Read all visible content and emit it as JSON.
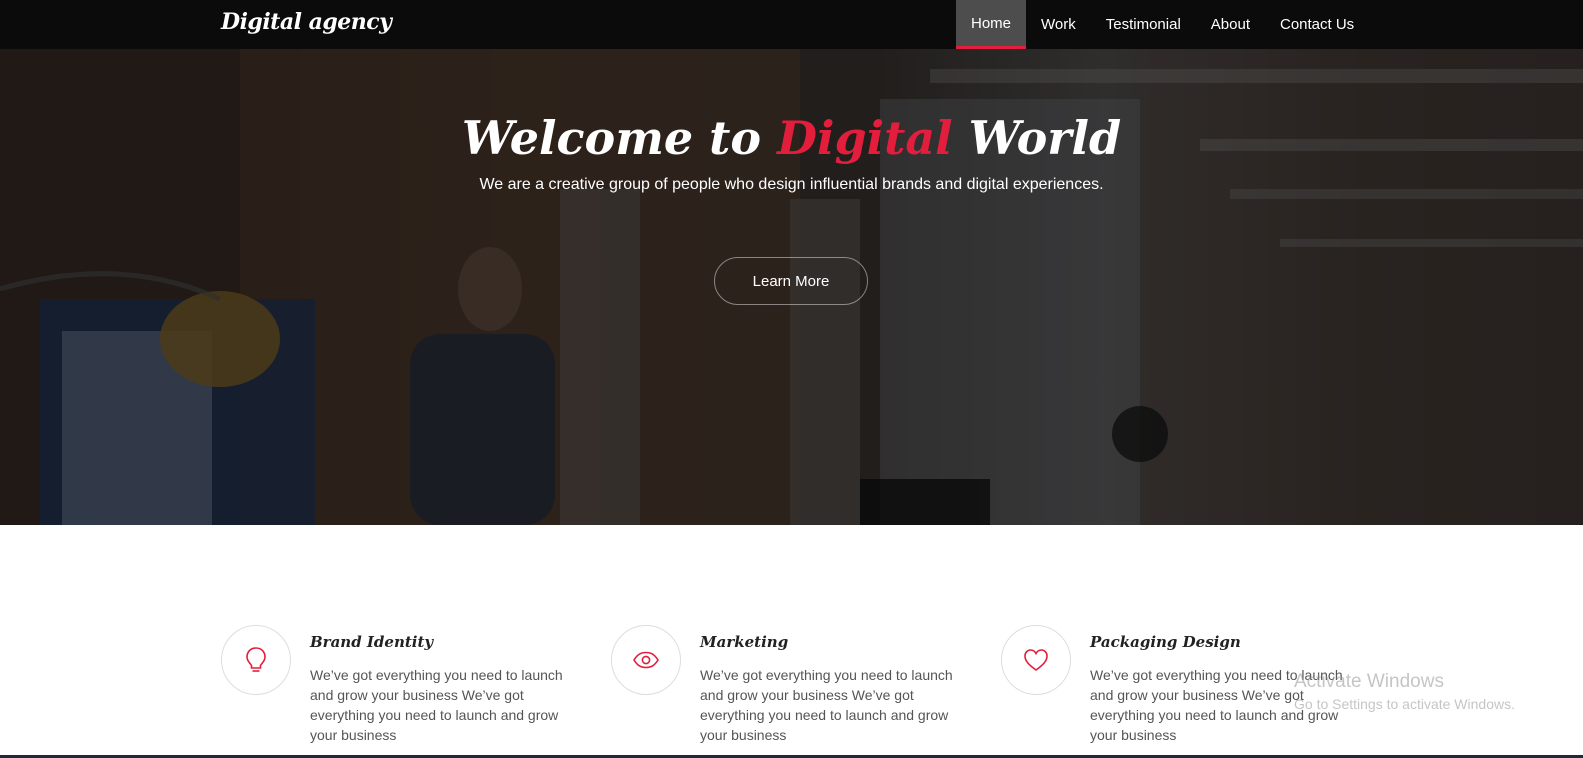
{
  "navbar": {
    "brand": "Digital agency",
    "items": [
      {
        "label": "Home",
        "active": true
      },
      {
        "label": "Work",
        "active": false
      },
      {
        "label": "Testimonial",
        "active": false
      },
      {
        "label": "About",
        "active": false
      },
      {
        "label": "Contact Us",
        "active": false
      }
    ]
  },
  "hero": {
    "title_prefix": "Welcome to",
    "title_accent": "Digital",
    "title_suffix": "World",
    "subtitle": "We are a creative group of people who design influential brands and digital experiences.",
    "cta_label": "Learn More"
  },
  "services": [
    {
      "icon": "lightbulb-icon",
      "title": "Brand Identity",
      "text": "We’ve got everything you need to launch and grow your business We’ve got everything you need to launch and grow your business"
    },
    {
      "icon": "eye-icon",
      "title": "Marketing",
      "text": "We’ve got everything you need to launch and grow your business We’ve got everything you need to launch and grow your business"
    },
    {
      "icon": "heart-icon",
      "title": "Packaging Design",
      "text": "We’ve got everything you need to launch and grow your business We’ve got everything you need to launch and grow your business"
    }
  ],
  "watermark": {
    "line1": "Activate Windows",
    "line2": "Go to Settings to activate Windows."
  },
  "colors": {
    "accent": "#e31e3c",
    "navbar_bg": "#0b0b0b",
    "active_nav_bg": "#4d4d4d"
  }
}
